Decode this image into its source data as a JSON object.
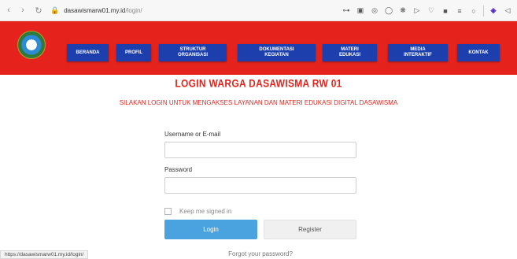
{
  "browser": {
    "url_host": "dasawismarw01.my.id",
    "url_path": "/login/",
    "status_url": "https://dasawismarw01.my.id/login/"
  },
  "header": {
    "menu": [
      {
        "label": "BERANDA"
      },
      {
        "label": "PROFIL"
      },
      {
        "label": "STRUKTUR\nORGANISASI"
      },
      {
        "label": "DOKUMENTASI\nKEGIATAN"
      },
      {
        "label": "MATERI\nEDUKASI"
      },
      {
        "label": "MEDIA\nINTERAKTIF"
      },
      {
        "label": "KONTAK"
      }
    ]
  },
  "content": {
    "title": "LOGIN WARGA DASAWISMA RW 01",
    "subtitle": "SILAKAN LOGIN UNTUK MENGAKSES LAYANAN DAN MATERI EDUKASI DIGITAL DASAWISMA"
  },
  "form": {
    "username_label": "Username or E-mail",
    "username_value": "",
    "password_label": "Password",
    "password_value": "",
    "remember_label": "Keep me signed in",
    "login_label": "Login",
    "register_label": "Register",
    "forgot_label": "Forgot your password?"
  },
  "colors": {
    "header_red": "#e5231c",
    "menu_blue": "#1d3fae",
    "login_blue": "#4aa3df"
  }
}
